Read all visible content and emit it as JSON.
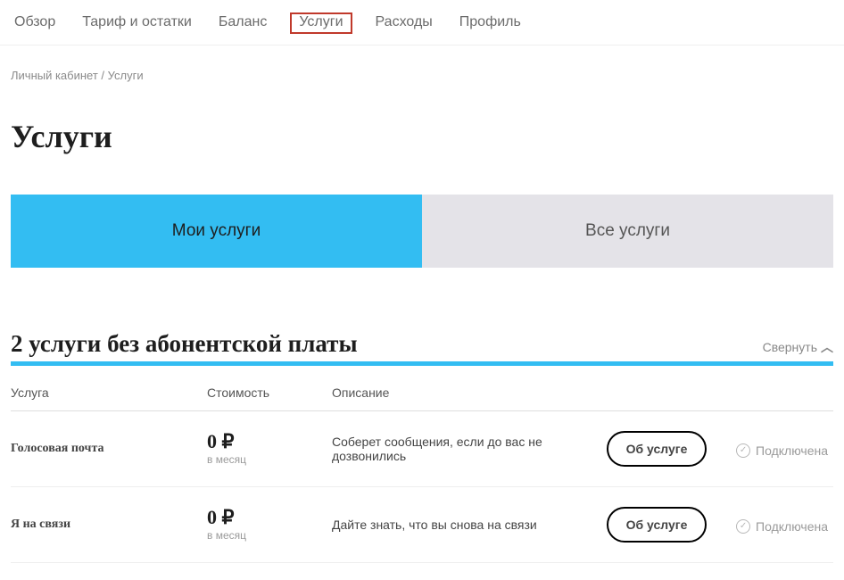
{
  "nav": {
    "items": [
      {
        "label": "Обзор",
        "active": false
      },
      {
        "label": "Тариф и остатки",
        "active": false
      },
      {
        "label": "Баланс",
        "active": false
      },
      {
        "label": "Услуги",
        "active": true
      },
      {
        "label": "Расходы",
        "active": false
      },
      {
        "label": "Профиль",
        "active": false
      }
    ]
  },
  "breadcrumb": {
    "root": "Личный кабинет",
    "sep": " / ",
    "current": "Услуги"
  },
  "page_title": "Услуги",
  "tabs": {
    "my": "Мои услуги",
    "all": "Все услуги"
  },
  "section": {
    "title": "2 услуги без абонентской платы",
    "collapse_label": "Свернуть"
  },
  "table": {
    "headers": {
      "name": "Услуга",
      "cost": "Стоимость",
      "desc": "Описание"
    },
    "rows": [
      {
        "name": "Голосовая почта",
        "price": "0 ₽",
        "period": "в месяц",
        "desc": "Соберет сообщения, если до вас не дозвонились",
        "button": "Об услуге",
        "status": "Подключена"
      },
      {
        "name": "Я на связи",
        "price": "0 ₽",
        "period": "в месяц",
        "desc": "Дайте знать, что вы снова на связи",
        "button": "Об услуге",
        "status": "Подключена"
      }
    ]
  }
}
